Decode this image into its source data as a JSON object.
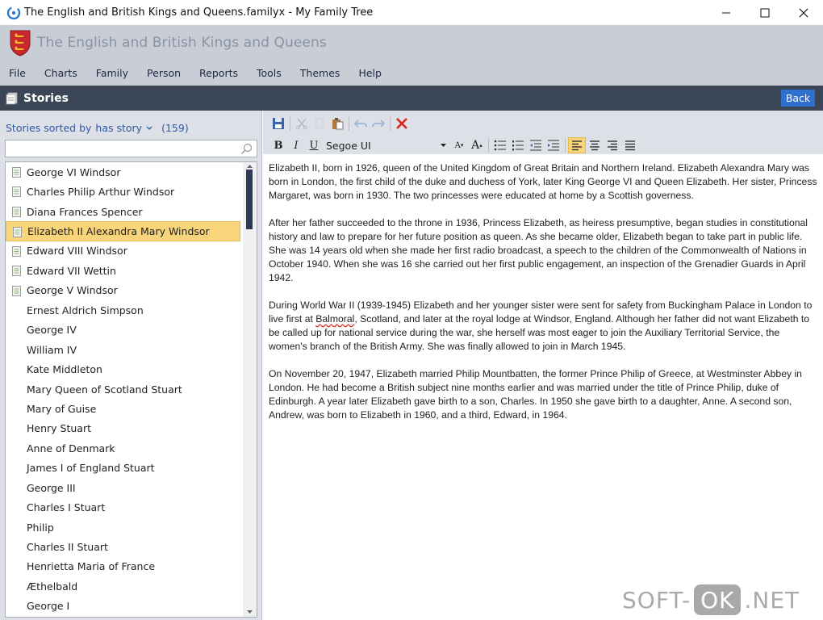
{
  "window": {
    "title": "The English and British Kings and Queens.familyx - My Family Tree",
    "controls": [
      "minimize-icon",
      "maximize-icon",
      "close-icon"
    ]
  },
  "banner": {
    "title": "The English and British Kings and Queens",
    "crest_icon": "royal-crest-icon"
  },
  "menu": {
    "items": [
      "File",
      "Charts",
      "Family",
      "Person",
      "Reports",
      "Tools",
      "Themes",
      "Help"
    ]
  },
  "section": {
    "title": "Stories",
    "back_label": "Back",
    "accent": "#2f6fcf",
    "bar_color": "#3a4556"
  },
  "sidebar": {
    "sort_label": "Stories sorted by",
    "sort_value": "has story",
    "count": "(159)",
    "search_placeholder": "",
    "selected_color": "#f8d47a",
    "items": [
      {
        "label": "George VI Windsor",
        "has_story": true
      },
      {
        "label": "Charles Philip Arthur Windsor",
        "has_story": true
      },
      {
        "label": "Diana Frances Spencer",
        "has_story": true
      },
      {
        "label": "Elizabeth II Alexandra Mary Windsor",
        "has_story": true,
        "selected": true
      },
      {
        "label": "Edward VIII Windsor",
        "has_story": true
      },
      {
        "label": "Edward VII Wettin",
        "has_story": true
      },
      {
        "label": "George V Windsor",
        "has_story": true
      },
      {
        "label": "Ernest Aldrich Simpson",
        "has_story": false
      },
      {
        "label": "George IV",
        "has_story": false
      },
      {
        "label": "William IV",
        "has_story": false
      },
      {
        "label": "Kate Middleton",
        "has_story": false
      },
      {
        "label": "Mary Queen of Scotland Stuart",
        "has_story": false
      },
      {
        "label": "Mary of Guise",
        "has_story": false
      },
      {
        "label": "Henry Stuart",
        "has_story": false
      },
      {
        "label": "Anne of Denmark",
        "has_story": false
      },
      {
        "label": "James I of England Stuart",
        "has_story": false
      },
      {
        "label": "George III",
        "has_story": false
      },
      {
        "label": "Charles I Stuart",
        "has_story": false
      },
      {
        "label": "Philip",
        "has_story": false
      },
      {
        "label": "Charles II Stuart",
        "has_story": false
      },
      {
        "label": "Henrietta Maria of France",
        "has_story": false
      },
      {
        "label": "Æthelbald",
        "has_story": false
      },
      {
        "label": "George I",
        "has_story": false
      }
    ]
  },
  "editor_toolbar": {
    "font_name": "Segoe UI",
    "bold_label": "B",
    "italic_label": "I",
    "underline_label": "U",
    "grow_label": "A",
    "shrink_label": "A"
  },
  "story": {
    "paragraphs": [
      "Elizabeth II, born in 1926, queen of the United Kingdom of Great Britain and Northern Ireland. Elizabeth Alexandra Mary was born in London, the first child of the duke and duchess of York, later King George VI and Queen Elizabeth. Her sister, Princess Margaret, was born in 1930. The two princesses were educated at home by a Scottish governess.",
      "After her father succeeded to the throne in 1936, Princess Elizabeth, as heiress presumptive, began studies in constitutional history and law to prepare for her future position as queen. As she became older, Elizabeth began to take part in public life. She was 14 years old when she made her first radio broadcast, a speech to the children of the Commonwealth of Nations in October 1940. When she was 16 she carried out her first public engagement, an inspection of the Grenadier Guards in April 1942.",
      "During World War II (1939-1945) Elizabeth and her younger sister were sent for safety from Buckingham Palace in London to live first at Balmoral, Scotland, and later at the royal lodge at Windsor, England. Although her father did not want Elizabeth to be called up for national service during the war, she herself was most eager to join the Auxiliary Territorial Service, the women's branch of the British Army. She was finally allowed to join in March 1945.",
      "On November 20, 1947, Elizabeth married Philip Mountbatten, the former Prince Philip of Greece, at Westminster Abbey in London. He had become a British subject nine months earlier and was married under the title of Prince Philip, duke of Edinburgh. A year later Elizabeth gave birth to a son, Charles. In 1950 she gave birth to a daughter, Anne. A second son, Andrew, was born to Elizabeth in 1960, and a third, Edward, in 1964."
    ],
    "p3_before": "During World War II (1939-1945) Elizabeth and her younger sister were sent for safety from Buckingham Palace in London to live first at ",
    "p3_misspelled": "Balmoral",
    "p3_after": ", Scotland, and later at the royal lodge at Windsor, England. Although her father did not want Elizabeth to be called up for national service during the war, she herself was most eager to join the Auxiliary Territorial Service, the women's branch of the British Army. She was finally allowed to join in March 1945."
  },
  "watermark": {
    "left": "SOFT-",
    "mid": "OK",
    "right": ".NET"
  }
}
